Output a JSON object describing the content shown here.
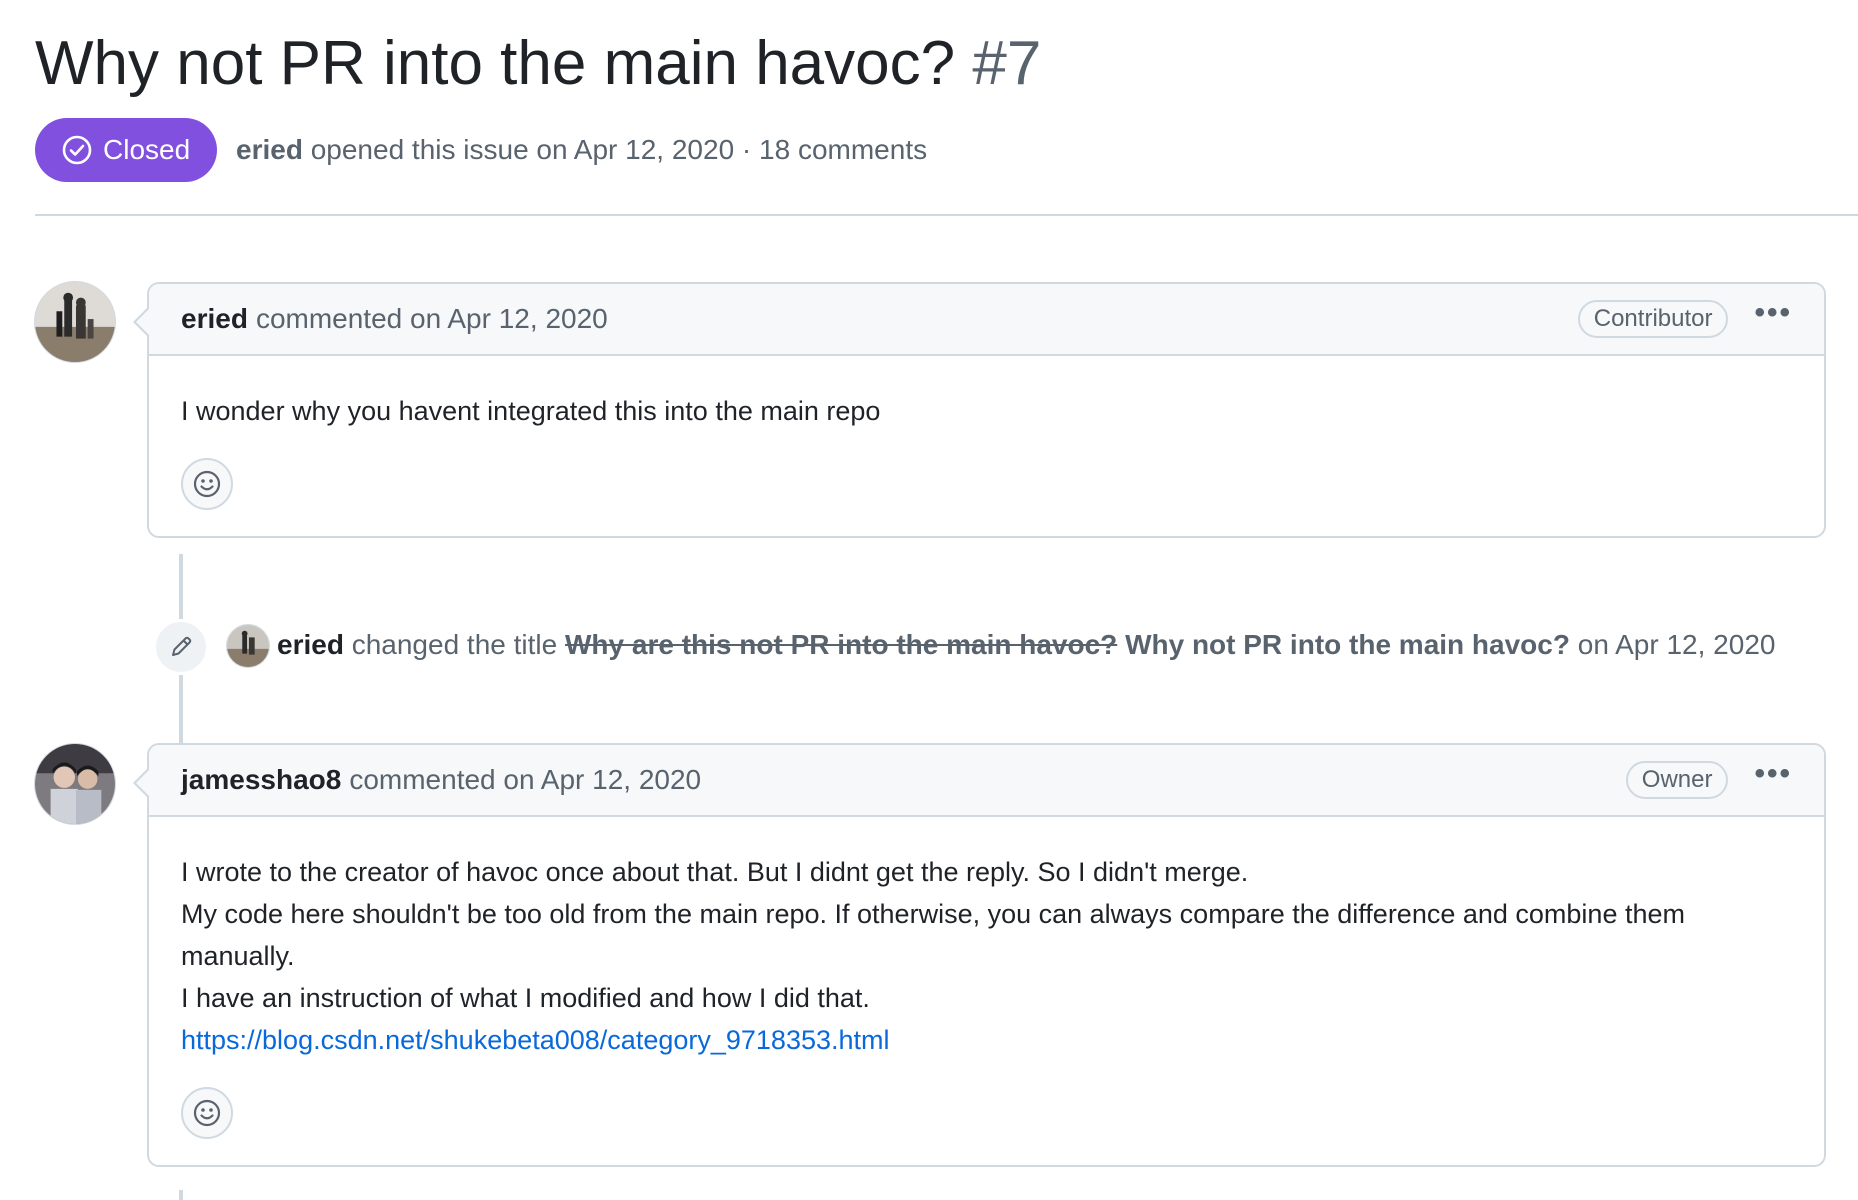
{
  "issue": {
    "title": "Why not PR into the main havoc?",
    "number": "#7",
    "state_label": "Closed",
    "author": "eried",
    "meta_text": "opened this issue on Apr 12, 2020 · 18 comments"
  },
  "comments": [
    {
      "author": "eried",
      "timestamp": "commented on Apr 12, 2020",
      "role": "Contributor",
      "menu_label": "•••",
      "body": [
        "I wonder why you havent integrated this into the main repo"
      ],
      "reaction_icon": "smiley-icon"
    },
    {
      "author": "jamesshao8",
      "timestamp": "commented on Apr 12, 2020",
      "role": "Owner",
      "menu_label": "•••",
      "body": [
        "I wrote to the creator of havoc once about that. But I didnt get the reply. So I didn't merge.",
        "My code here shouldn't be too old from the main repo. If otherwise, you can always compare the difference and combine them manually.",
        "I have an instruction of what I modified and how I did that."
      ],
      "link": "https://blog.csdn.net/shukebeta008/category_9718353.html",
      "reaction_icon": "smiley-icon"
    }
  ],
  "event": {
    "icon": "pencil-icon",
    "author": "eried",
    "action": "changed the title",
    "old_title": "Why are this not PR into the main havoc?",
    "new_title": "Why not PR into the main havoc?",
    "timestamp": "on Apr 12, 2020"
  },
  "colors": {
    "closed_badge": "#8250df",
    "link": "#0969da",
    "border": "#d1d9e0",
    "header_bg": "#f6f8fa",
    "muted_text": "#59636e"
  }
}
